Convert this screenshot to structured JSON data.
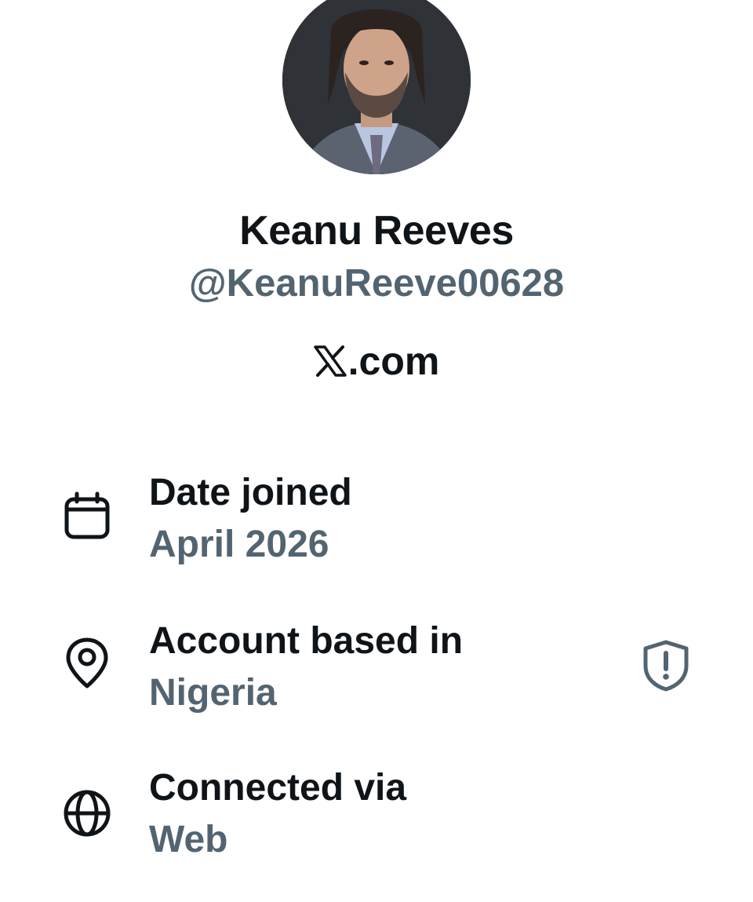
{
  "profile": {
    "name": "Keanu Reeves",
    "handle": "@KeanuReeve00628",
    "site": ".com",
    "avatar_icon": "profile-photo"
  },
  "details": [
    {
      "icon": "calendar-icon",
      "label": "Date joined",
      "value": "April 2026"
    },
    {
      "icon": "location-pin-icon",
      "label": "Account based in",
      "value": "Nigeria",
      "trailing_icon": "shield-alert-icon"
    },
    {
      "icon": "globe-icon",
      "label": "Connected via",
      "value": "Web"
    }
  ],
  "colors": {
    "primary_text": "#0f1419",
    "secondary_text": "#536471",
    "background": "#ffffff"
  }
}
